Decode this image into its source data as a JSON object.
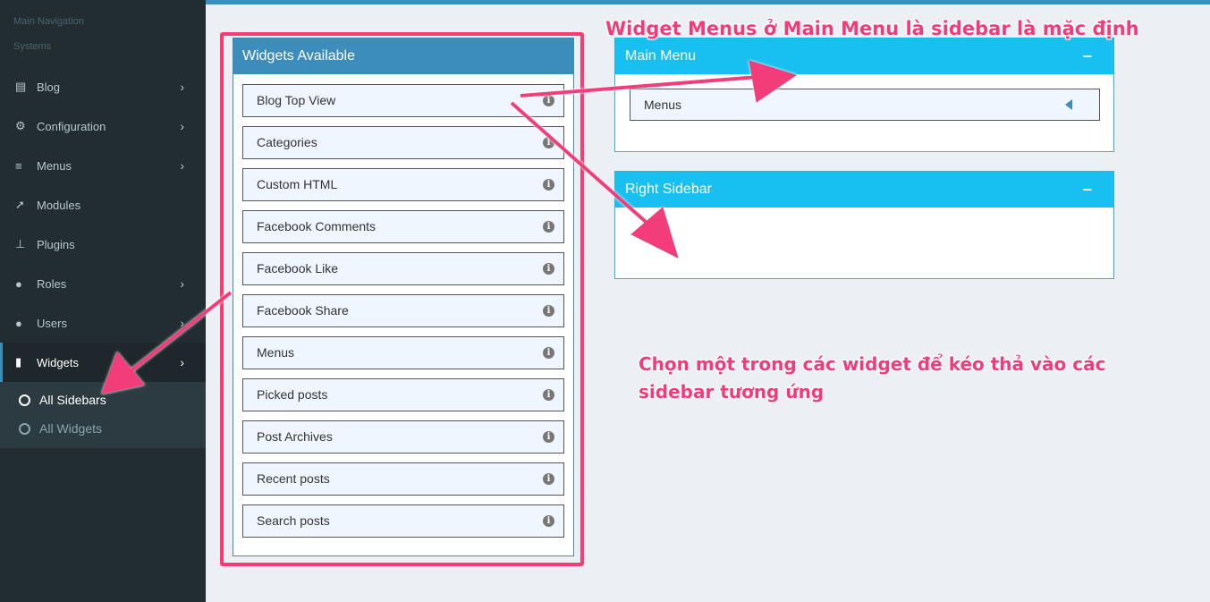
{
  "sidebar": {
    "header_main": "Main Navigation",
    "header_systems": "Systems",
    "items": [
      {
        "label": "Blog",
        "icon": "newspaper-icon",
        "glyph": "▤",
        "has_arrow": true
      },
      {
        "label": "Configuration",
        "icon": "gear-icon",
        "glyph": "⚙",
        "has_arrow": true
      },
      {
        "label": "Menus",
        "icon": "bars-icon",
        "glyph": "≡",
        "has_arrow": true
      },
      {
        "label": "Modules",
        "icon": "rocket-icon",
        "glyph": "➚",
        "has_arrow": false
      },
      {
        "label": "Plugins",
        "icon": "thumbtack-icon",
        "glyph": "⊥",
        "has_arrow": false
      },
      {
        "label": "Roles",
        "icon": "users-icon",
        "glyph": "●",
        "has_arrow": true
      },
      {
        "label": "Users",
        "icon": "user-icon",
        "glyph": "●",
        "has_arrow": true
      },
      {
        "label": "Widgets",
        "icon": "file-icon",
        "glyph": "▮",
        "has_arrow": true,
        "active": true
      }
    ],
    "sub_items": [
      {
        "label": "All Sidebars",
        "active": true
      },
      {
        "label": "All Widgets",
        "active": false
      }
    ],
    "arrow_glyph": "›"
  },
  "widgets_available": {
    "title": "Widgets Available",
    "items": [
      "Blog Top View",
      "Categories",
      "Custom HTML",
      "Facebook Comments",
      "Facebook Like",
      "Facebook Share",
      "Menus",
      "Picked posts",
      "Post Archives",
      "Recent posts",
      "Search posts"
    ],
    "info_glyph": "i"
  },
  "sidebars": {
    "main_menu": {
      "title": "Main Menu",
      "collapse": "−",
      "widgets": [
        "Menus"
      ]
    },
    "right_sidebar": {
      "title": "Right Sidebar",
      "collapse": "−"
    }
  },
  "annotations": {
    "top": "Widget Menus ở Main Menu là sidebar là mặc định",
    "middle": "Chọn một trong các widget để kéo thả vào các sidebar tương ứng",
    "color": "#f23c7a"
  },
  "colors": {
    "sidebar_bg": "#222d32",
    "primary": "#3c8dbc",
    "sidebar_header": "#17c0f0",
    "highlight": "#fb3a6f",
    "content_bg": "#ecf0f5"
  }
}
